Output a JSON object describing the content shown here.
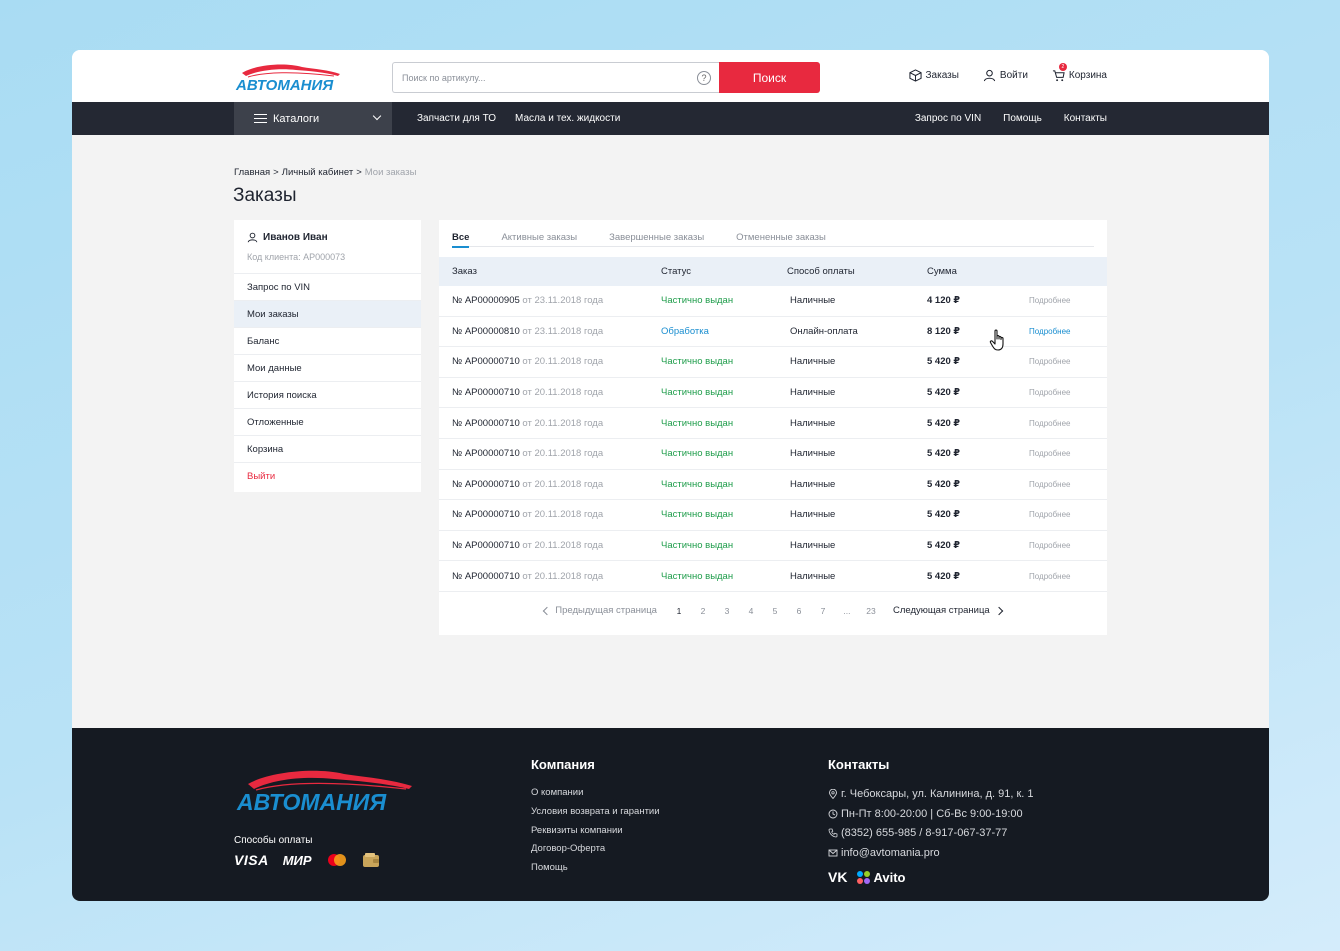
{
  "header": {
    "logo_text": "АВТОМАНИЯ",
    "search_placeholder": "Поиск по артикулу...",
    "search_help": "?",
    "search_button": "Поиск",
    "orders_link": "Заказы",
    "login_link": "Войти",
    "cart_link": "Корзина",
    "cart_count": "2"
  },
  "nav": {
    "catalog": "Каталоги",
    "left": [
      "Запчасти для ТО",
      "Масла и тех. жидкости"
    ],
    "right": [
      "Запрос по VIN",
      "Помощь",
      "Контакты"
    ]
  },
  "breadcrumb": [
    "Главная",
    "Личный кабинет",
    "Мои заказы"
  ],
  "breadcrumb_sep": ">",
  "page_title": "Заказы",
  "sidebar": {
    "user_name": "Иванов Иван",
    "client_code": "Код клиента: АР000073",
    "items": [
      "Запрос по VIN",
      "Мои заказы",
      "Баланс",
      "Мои данные",
      "История поиска",
      "Отложенные",
      "Корзина",
      "Выйти"
    ]
  },
  "tabs": [
    "Все",
    "Активные заказы",
    "Завершенные заказы",
    "Отмененные заказы"
  ],
  "table": {
    "headers": [
      "Заказ",
      "Статус",
      "Способ оплаты",
      "Сумма"
    ],
    "rows": [
      {
        "num": "№ АР00000905",
        "date": "от 23.11.2018 года",
        "status": "Частично выдан",
        "pay": "Наличные",
        "sum": "4 120 ₽",
        "more": "Подробнее"
      },
      {
        "num": "№ АР00000810",
        "date": "от 23.11.2018 года",
        "status": "Обработка",
        "pay": "Онлайн-оплата",
        "sum": "8 120 ₽",
        "more": "Подробнее"
      },
      {
        "num": "№ АР00000710",
        "date": "от 20.11.2018 года",
        "status": "Частично выдан",
        "pay": "Наличные",
        "sum": "5 420 ₽",
        "more": "Подробнее"
      },
      {
        "num": "№ АР00000710",
        "date": "от 20.11.2018 года",
        "status": "Частично выдан",
        "pay": "Наличные",
        "sum": "5 420 ₽",
        "more": "Подробнее"
      },
      {
        "num": "№ АР00000710",
        "date": "от 20.11.2018 года",
        "status": "Частично выдан",
        "pay": "Наличные",
        "sum": "5 420 ₽",
        "more": "Подробнее"
      },
      {
        "num": "№ АР00000710",
        "date": "от 20.11.2018 года",
        "status": "Частично выдан",
        "pay": "Наличные",
        "sum": "5 420 ₽",
        "more": "Подробнее"
      },
      {
        "num": "№ АР00000710",
        "date": "от 20.11.2018 года",
        "status": "Частично выдан",
        "pay": "Наличные",
        "sum": "5 420 ₽",
        "more": "Подробнее"
      },
      {
        "num": "№ АР00000710",
        "date": "от 20.11.2018 года",
        "status": "Частично выдан",
        "pay": "Наличные",
        "sum": "5 420 ₽",
        "more": "Подробнее"
      },
      {
        "num": "№ АР00000710",
        "date": "от 20.11.2018 года",
        "status": "Частично выдан",
        "pay": "Наличные",
        "sum": "5 420 ₽",
        "more": "Подробнее"
      },
      {
        "num": "№ АР00000710",
        "date": "от 20.11.2018 года",
        "status": "Частично выдан",
        "pay": "Наличные",
        "sum": "5 420 ₽",
        "more": "Подробнее"
      }
    ]
  },
  "pager": {
    "prev": "Предыдущая страница",
    "next": "Следующая страница",
    "pages": [
      "1",
      "2",
      "3",
      "4",
      "5",
      "6",
      "7",
      "...",
      "23"
    ],
    "current": "1"
  },
  "footer": {
    "logo_text": "АВТОМАНИЯ",
    "payment_title": "Способы оплаты",
    "payment_methods": [
      "VISA",
      "МИР"
    ],
    "company_title": "Компания",
    "company_links": [
      "О компании",
      "Условия возврата и гарантии",
      "Реквизиты компании",
      "Договор-Оферта",
      "Помощь"
    ],
    "contacts_title": "Контакты",
    "address": "г. Чебоксары, ул. Калинина, д. 91, к. 1",
    "hours": "Пн-Пт 8:00-20:00 | Сб-Вс 9:00-19:00",
    "phones": "(8352) 655-985 / 8-917-067-37-77",
    "email": "info@avtomania.pro",
    "social": [
      "VK",
      "Avito"
    ]
  },
  "colors": {
    "accent_red": "#e8293f",
    "accent_blue": "#1a8ed0",
    "status_green": "#1f9d4b",
    "nav_dark": "#242833",
    "footer_dark": "#151a22"
  }
}
